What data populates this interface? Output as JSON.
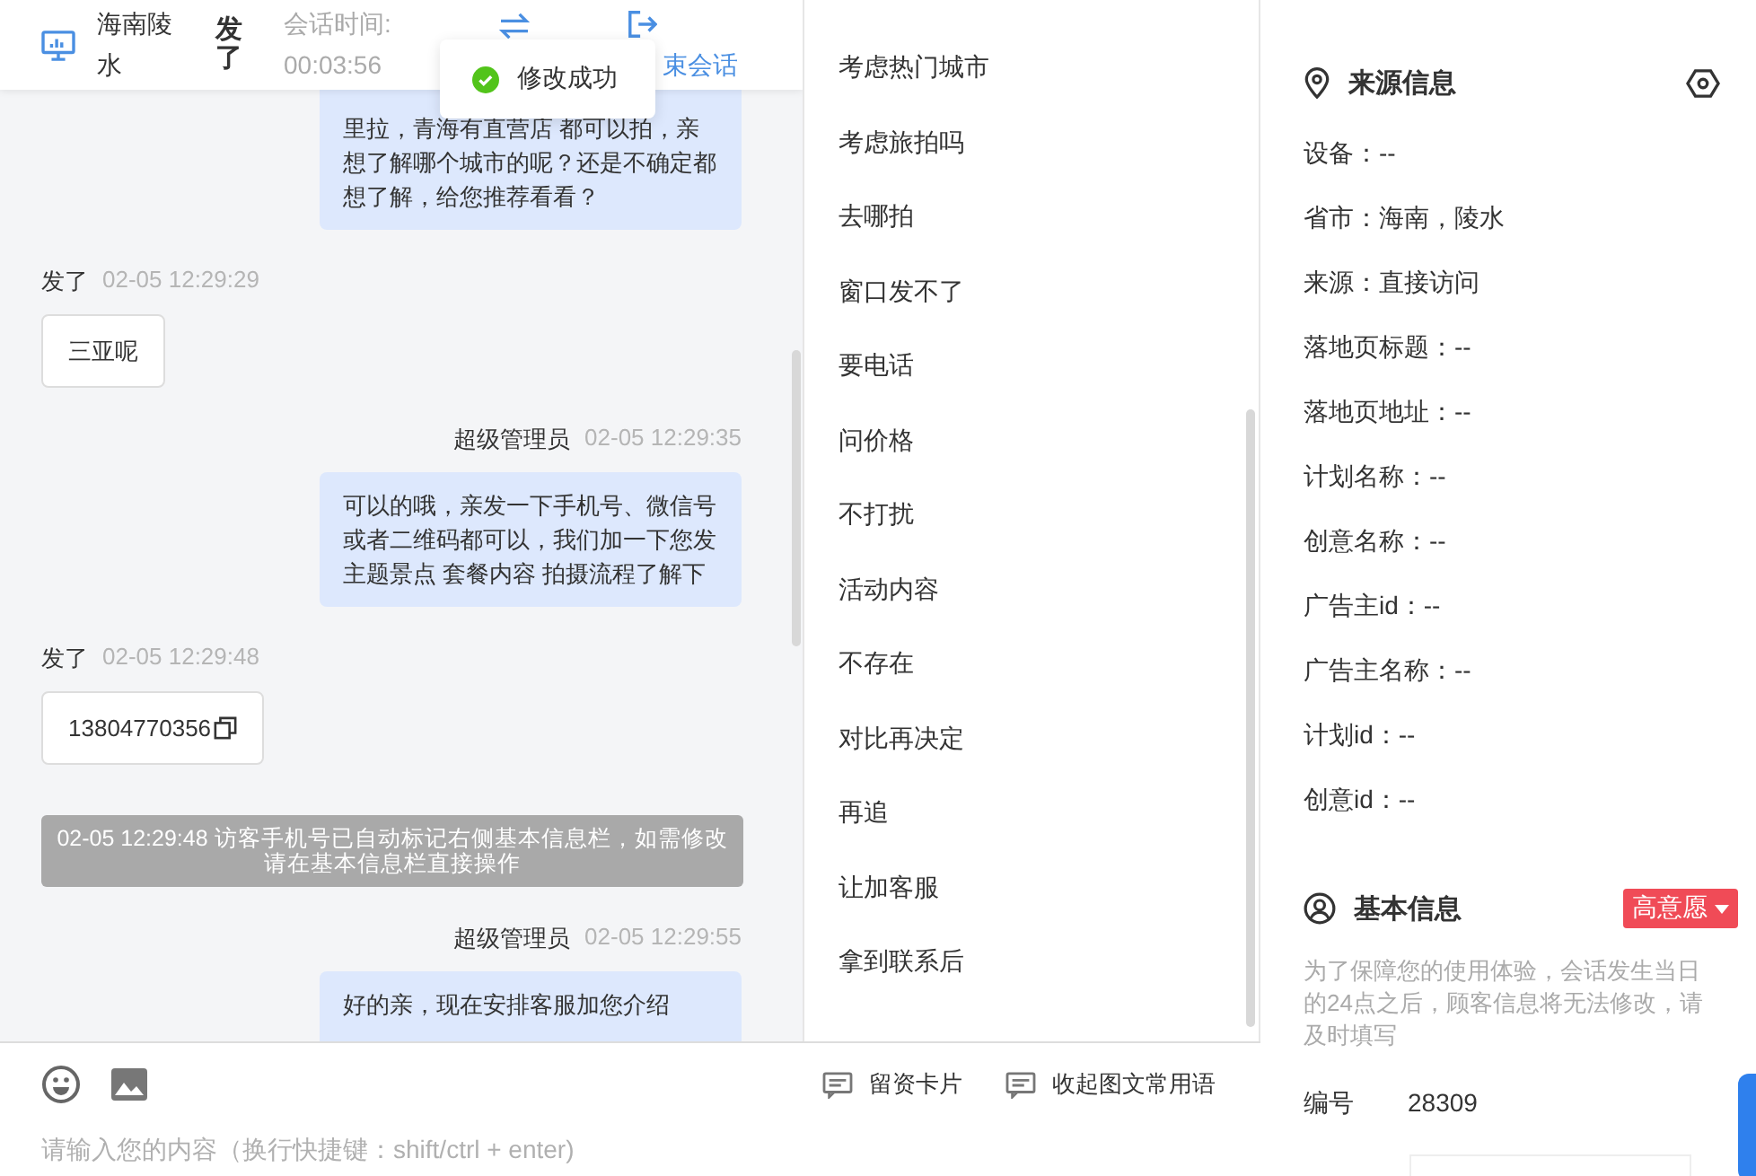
{
  "header": {
    "visitor_name": "海南陵水",
    "last_message": "发了",
    "session_time_label": "会话时间:",
    "session_time": "00:03:56",
    "end_session": "束会话"
  },
  "toast": {
    "kind": "success",
    "text": "修改成功"
  },
  "messages": [
    {
      "kind": "agent",
      "text": "里拉，青海有直营店 都可以拍，亲想了解哪个城市的呢？还是不确定都想了解，给您推荐看看？"
    },
    {
      "kind": "visitor",
      "sender": "发了",
      "time": "02-05 12:29:29",
      "text": "三亚呢"
    },
    {
      "kind": "agent",
      "sender": "超级管理员",
      "time": "02-05 12:29:35",
      "text": "可以的哦，亲发一下手机号、微信号或者二维码都可以，我们加一下您发主题景点 套餐内容 拍摄流程了解下"
    },
    {
      "kind": "visitor",
      "sender": "发了",
      "time": "02-05 12:29:48",
      "text": "13804770356",
      "copyable": true
    },
    {
      "kind": "system",
      "text": "02-05 12:29:48 访客手机号已自动标记右侧基本信息栏，如需修改请在基本信息栏直接操作"
    },
    {
      "kind": "agent",
      "sender": "超级管理员",
      "time": "02-05 12:29:55",
      "text": "好的亲，现在安排客服加您介绍"
    }
  ],
  "quick_replies": [
    "考虑热门城市",
    "考虑旅拍吗",
    "去哪拍",
    "窗口发不了",
    "要电话",
    "问价格",
    "不打扰",
    "活动内容",
    "不存在",
    "对比再决定",
    "再追",
    "让加客服",
    "拿到联系后"
  ],
  "toolbar": {
    "buttons": [
      "留资卡片",
      "收起图文常用语"
    ]
  },
  "input": {
    "placeholder": "请输入您的内容（换行快捷键：shift/ctrl + enter)"
  },
  "source_info": {
    "title": "来源信息",
    "fields": [
      "设备：--",
      "省市：海南，陵水",
      "来源：直接访问",
      "落地页标题：--",
      "落地页地址：--",
      "计划名称：--",
      "创意名称：--",
      "广告主id：--",
      "广告主名称：--",
      "计划id：--",
      "创意id：--"
    ]
  },
  "basic_info": {
    "title": "基本信息",
    "intent_tag": "高意愿",
    "note": "为了保障您的使用体验，会话发生当日的24点之后，顾客信息将无法修改，请及时填写",
    "number_label": "编号",
    "number": "28309"
  }
}
